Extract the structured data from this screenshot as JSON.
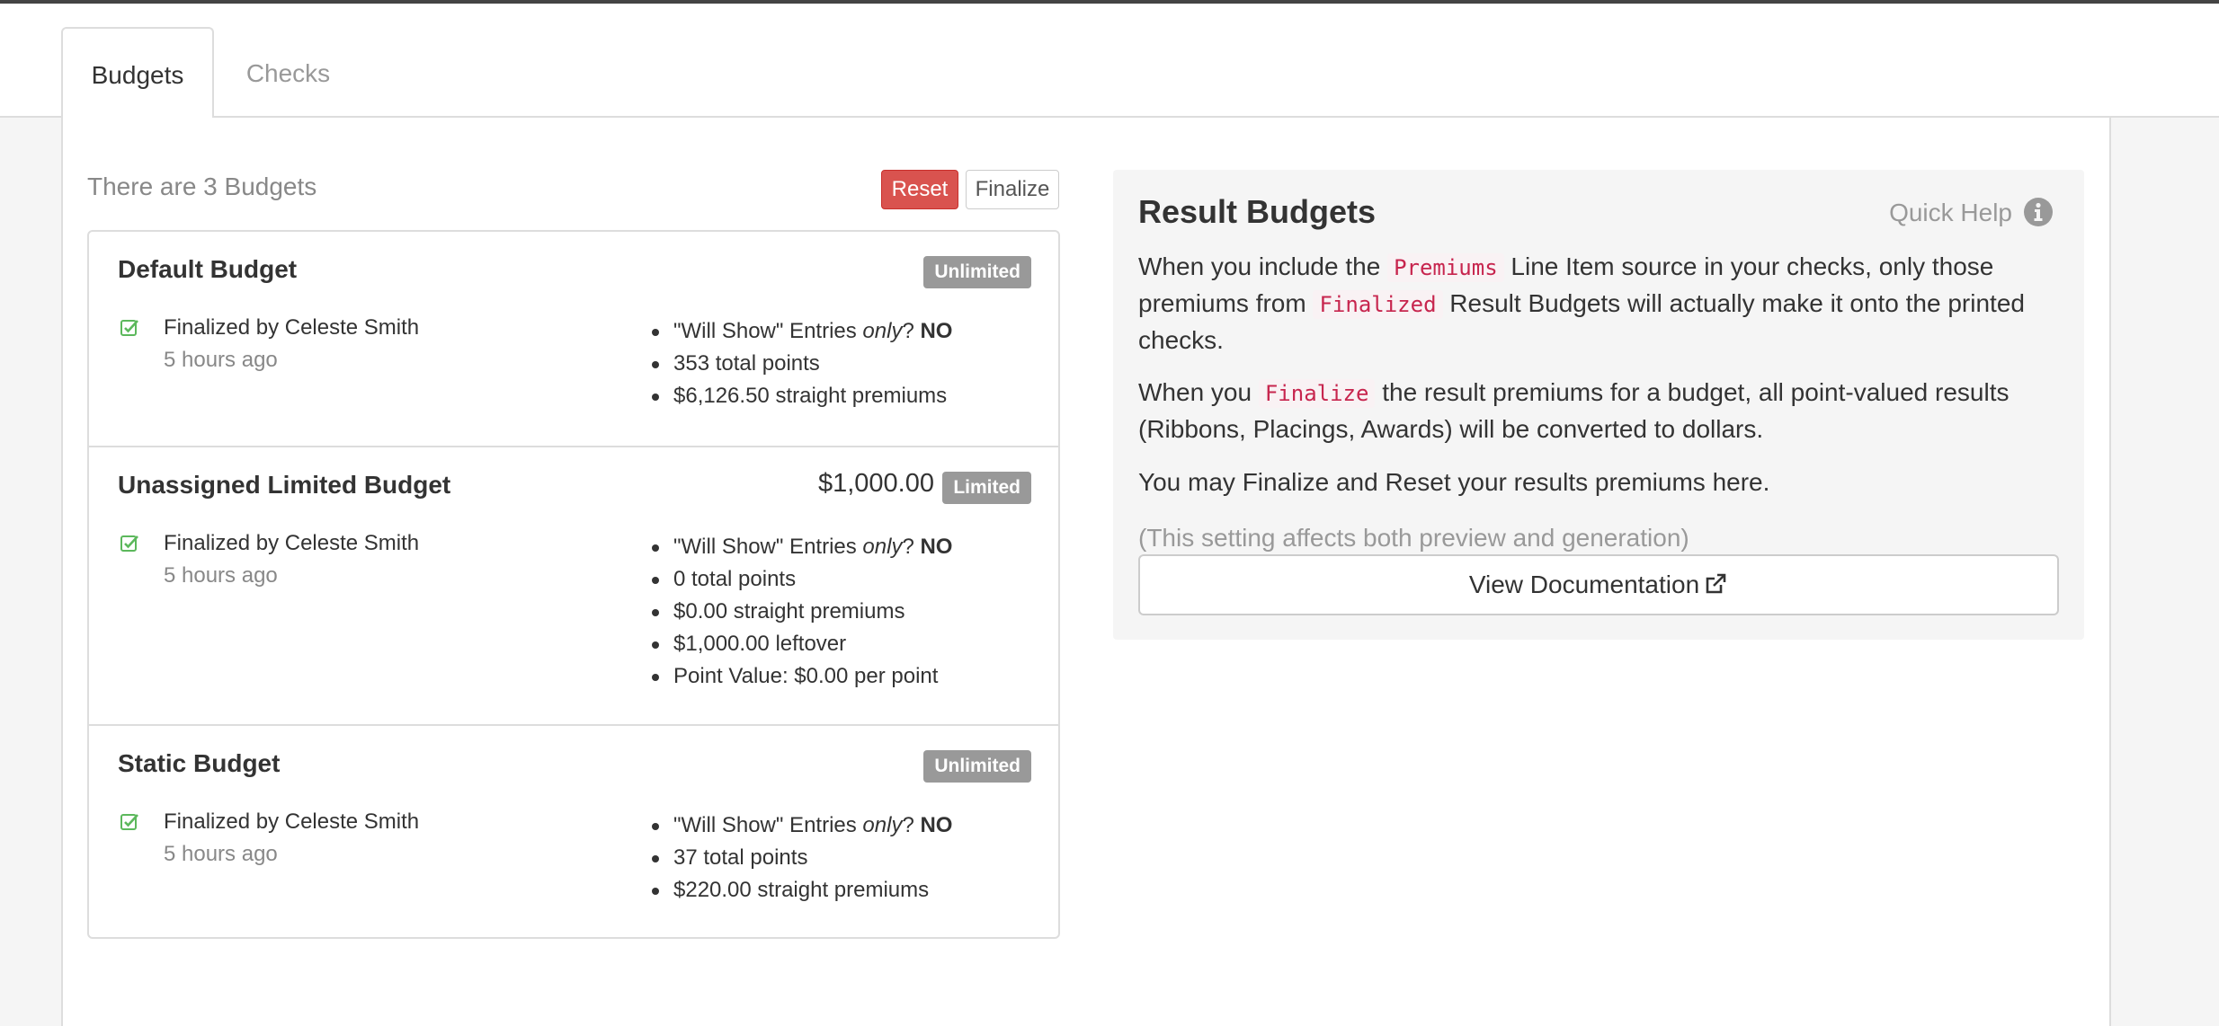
{
  "tabs": [
    {
      "label": "Budgets"
    },
    {
      "label": "Checks"
    }
  ],
  "budgets_header": {
    "count_text": "There are 3 Budgets",
    "reset_label": "Reset",
    "finalize_label": "Finalize"
  },
  "budgets": [
    {
      "name": "Default Budget",
      "amount": "",
      "badge": "Unlimited",
      "finalized_by": "Finalized by Celeste Smith",
      "finalized_ago": "5 hours ago",
      "will_show_prefix": "\"Will Show\" Entries ",
      "will_show_only": "only",
      "will_show_q": "? ",
      "will_show_value": "NO",
      "stats": [
        "353 total points",
        "$6,126.50 straight premiums"
      ]
    },
    {
      "name": "Unassigned Limited Budget",
      "amount": "$1,000.00",
      "badge": "Limited",
      "finalized_by": "Finalized by Celeste Smith",
      "finalized_ago": "5 hours ago",
      "will_show_prefix": "\"Will Show\" Entries ",
      "will_show_only": "only",
      "will_show_q": "? ",
      "will_show_value": "NO",
      "stats": [
        "0 total points",
        "$0.00 straight premiums",
        "$1,000.00 leftover",
        "Point Value: $0.00 per point"
      ]
    },
    {
      "name": "Static Budget",
      "amount": "",
      "badge": "Unlimited",
      "finalized_by": "Finalized by Celeste Smith",
      "finalized_ago": "5 hours ago",
      "will_show_prefix": "\"Will Show\" Entries ",
      "will_show_only": "only",
      "will_show_q": "? ",
      "will_show_value": "NO",
      "stats": [
        "37 total points",
        "$220.00 straight premiums"
      ]
    }
  ],
  "help": {
    "title": "Result Budgets",
    "quick_help_label": "Quick Help",
    "p1_a": "When you include the ",
    "p1_code1": "Premiums",
    "p1_b": " Line Item source in your checks, only those premiums from ",
    "p1_code2": "Finalized",
    "p1_c": " Result Budgets will actually make it onto the printed checks.",
    "p2_a": "When you ",
    "p2_code": "Finalize",
    "p2_b": " the result premiums for a budget, all point-valued results (Ribbons, Placings, Awards) will be converted to dollars.",
    "p3": "You may Finalize and Reset your results premiums here.",
    "p4": "(This setting affects both preview and generation)",
    "doc_button_label": "View Documentation"
  },
  "colors": {
    "danger": "#d9534f",
    "badge_gray": "#999999",
    "success_check": "#5cb85c",
    "code_text": "#c7254e"
  }
}
